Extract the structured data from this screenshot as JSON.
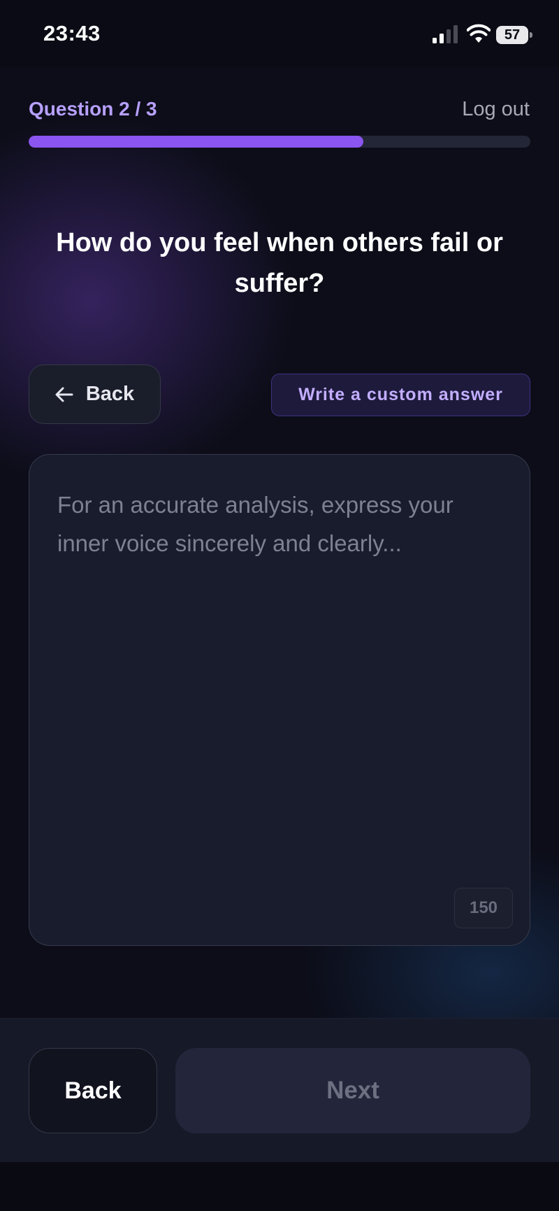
{
  "status_bar": {
    "time": "23:43",
    "battery_level": "57",
    "signal_icon": "cellular-signal-icon",
    "wifi_icon": "wifi-icon",
    "battery_icon": "battery-icon"
  },
  "header": {
    "question_counter": "Question 2 / 3",
    "logout_label": "Log out",
    "progress_fraction": 0.667
  },
  "question": {
    "title": "How do you feel when others fail or suffer?"
  },
  "actions": {
    "back_label": "Back",
    "back_icon": "arrow-left-icon",
    "custom_answer_label": "Write a custom answer"
  },
  "answer": {
    "value": "",
    "placeholder": "For an accurate analysis, express your inner voice sincerely and clearly...",
    "char_counter": "150"
  },
  "footer": {
    "back_label": "Back",
    "next_label": "Next"
  },
  "colors": {
    "accent": "#8a55f0",
    "accent_text": "#b7a0ff",
    "background": "#0c0d18",
    "surface": "#191c2c"
  }
}
